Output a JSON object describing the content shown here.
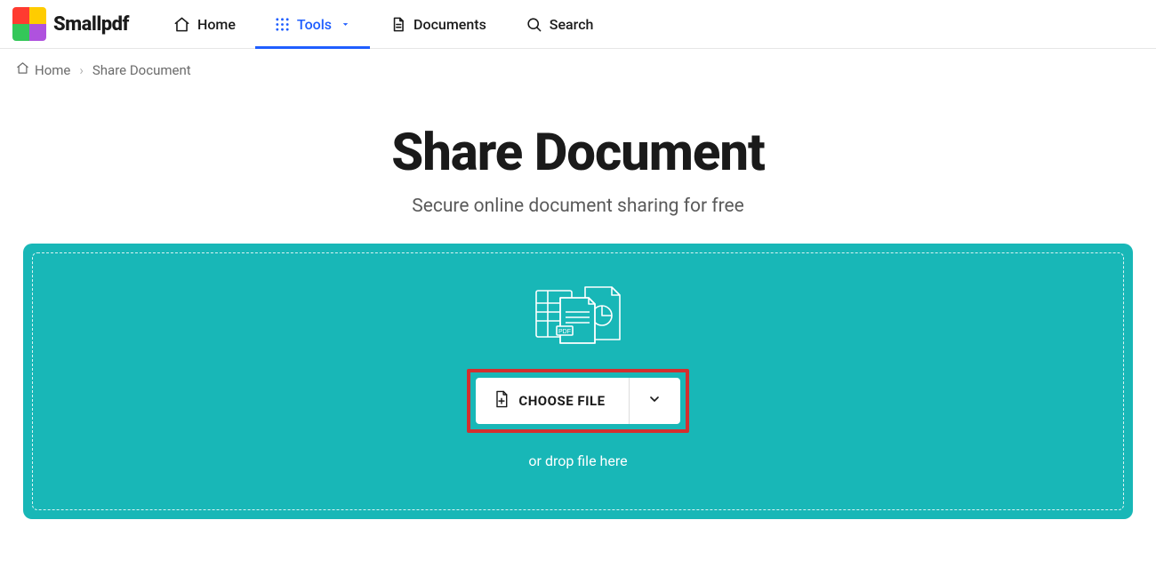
{
  "brand": "Smallpdf",
  "nav": {
    "home": "Home",
    "tools": "Tools",
    "documents": "Documents",
    "search": "Search"
  },
  "breadcrumb": {
    "home": "Home",
    "current": "Share Document"
  },
  "hero": {
    "title": "Share Document",
    "subtitle": "Secure online document sharing for free"
  },
  "drop": {
    "choose_label": "CHOOSE FILE",
    "hint": "or drop file here"
  }
}
